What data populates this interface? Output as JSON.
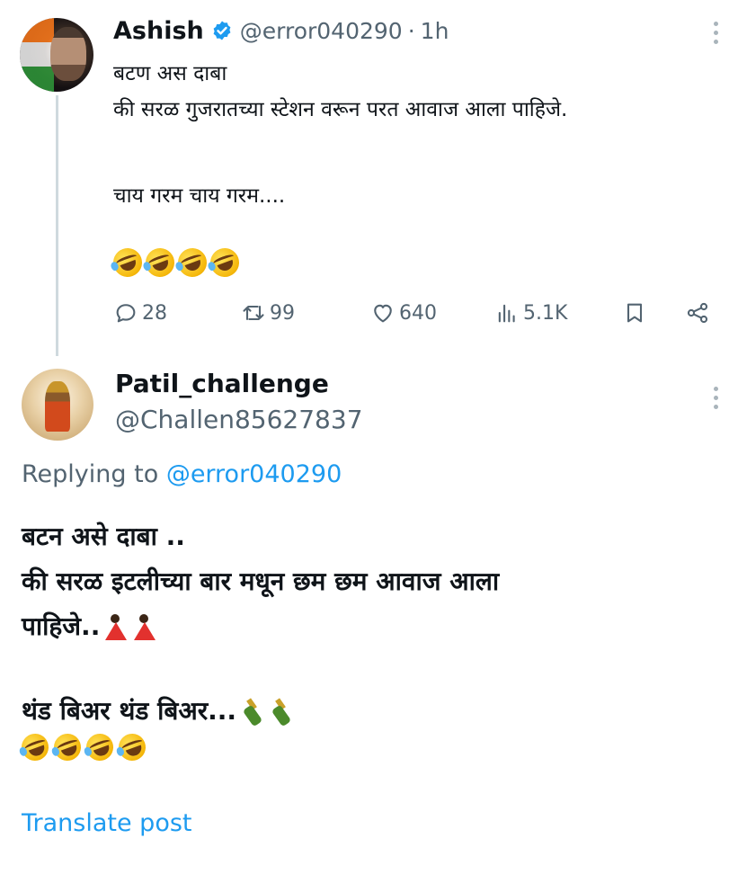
{
  "tweet": {
    "author_name": "Ashish",
    "handle": "@error040290",
    "separator": "·",
    "time": "1h",
    "lines": [
      "बटण अस दाबा",
      "की सरळ गुजरातच्या स्टेशन वरून परत आवाज आला पाहिजे.",
      "चाय गरम चाय गरम...."
    ],
    "emoji_count": 4,
    "emoji_name": "rolling-on-floor-laughing",
    "actions": {
      "replies": "28",
      "reposts": "99",
      "likes": "640",
      "views": "5.1K"
    }
  },
  "reply": {
    "author_name": "Patil_challenge",
    "handle": "@Challen85627837",
    "replying_to_label": "Replying to",
    "replying_to_handle": "@error040290",
    "lines": [
      "बटन असे दाबा ..",
      "की सरळ इटलीच्या बार मधून छम छम आवाज आला",
      "पाहिजे..",
      "थंड बिअर थंड बिअर..."
    ],
    "emojis_line3": [
      "dancer",
      "dancer"
    ],
    "emojis_line4": [
      "champagne-bottle",
      "champagne-bottle"
    ],
    "laugh_emoji_count": 4,
    "translate_label": "Translate post"
  },
  "colors": {
    "text": "#0f1419",
    "secondary": "#536471",
    "link": "#1d9bf0",
    "thread_line": "#cfd9de"
  }
}
